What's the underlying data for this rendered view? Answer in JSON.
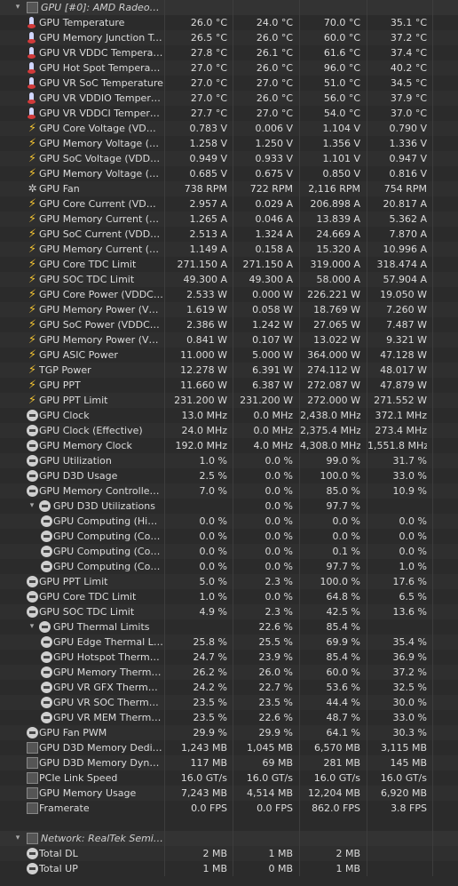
{
  "sections": [
    {
      "header": "GPU [#0]: AMD Radeon R...",
      "rows": [
        {
          "icon": "temp",
          "label": "GPU Temperature",
          "v": [
            "26.0 °C",
            "24.0 °C",
            "70.0 °C",
            "35.1 °C"
          ]
        },
        {
          "icon": "temp",
          "label": "GPU Memory Junction Tem...",
          "v": [
            "26.5 °C",
            "26.0 °C",
            "60.0 °C",
            "37.2 °C"
          ]
        },
        {
          "icon": "temp",
          "label": "GPU VR VDDC Temperature",
          "v": [
            "27.8 °C",
            "26.1 °C",
            "61.6 °C",
            "37.4 °C"
          ]
        },
        {
          "icon": "temp",
          "label": "GPU Hot Spot Temperature",
          "v": [
            "27.0 °C",
            "26.0 °C",
            "96.0 °C",
            "40.2 °C"
          ]
        },
        {
          "icon": "temp",
          "label": "GPU VR SoC Temperature",
          "v": [
            "27.0 °C",
            "27.0 °C",
            "51.0 °C",
            "34.5 °C"
          ]
        },
        {
          "icon": "temp",
          "label": "GPU VR VDDIO Temperature",
          "v": [
            "27.0 °C",
            "26.0 °C",
            "56.0 °C",
            "37.9 °C"
          ]
        },
        {
          "icon": "temp",
          "label": "GPU VR VDDCI Temperature",
          "v": [
            "27.7 °C",
            "27.0 °C",
            "54.0 °C",
            "37.0 °C"
          ]
        },
        {
          "icon": "volt",
          "label": "GPU Core Voltage (VDDCR...",
          "v": [
            "0.783 V",
            "0.006 V",
            "1.104 V",
            "0.790 V"
          ]
        },
        {
          "icon": "volt",
          "label": "GPU Memory Voltage (VDD...",
          "v": [
            "1.258 V",
            "1.250 V",
            "1.356 V",
            "1.336 V"
          ]
        },
        {
          "icon": "volt",
          "label": "GPU SoC Voltage (VDDCR_...",
          "v": [
            "0.949 V",
            "0.933 V",
            "1.101 V",
            "0.947 V"
          ]
        },
        {
          "icon": "volt",
          "label": "GPU Memory Voltage (VDD...",
          "v": [
            "0.685 V",
            "0.675 V",
            "0.850 V",
            "0.816 V"
          ]
        },
        {
          "icon": "fan",
          "label": "GPU Fan",
          "v": [
            "738 RPM",
            "722 RPM",
            "2,116 RPM",
            "754 RPM"
          ]
        },
        {
          "icon": "volt",
          "label": "GPU Core Current (VDDCR...",
          "v": [
            "2.957 A",
            "0.029 A",
            "206.898 A",
            "20.817 A"
          ]
        },
        {
          "icon": "volt",
          "label": "GPU Memory Current (VDD...",
          "v": [
            "1.265 A",
            "0.046 A",
            "13.839 A",
            "5.362 A"
          ]
        },
        {
          "icon": "volt",
          "label": "GPU SoC Current (VDDCR...",
          "v": [
            "2.513 A",
            "1.324 A",
            "24.669 A",
            "7.870 A"
          ]
        },
        {
          "icon": "volt",
          "label": "GPU Memory Current (VDD...",
          "v": [
            "1.149 A",
            "0.158 A",
            "15.320 A",
            "10.996 A"
          ]
        },
        {
          "icon": "volt",
          "label": "GPU Core TDC Limit",
          "v": [
            "271.150 A",
            "271.150 A",
            "319.000 A",
            "318.474 A"
          ]
        },
        {
          "icon": "volt",
          "label": "GPU SOC TDC Limit",
          "v": [
            "49.300 A",
            "49.300 A",
            "58.000 A",
            "57.904 A"
          ]
        },
        {
          "icon": "volt",
          "label": "GPU Core Power (VDDCR_...",
          "v": [
            "2.533 W",
            "0.000 W",
            "226.221 W",
            "19.050 W"
          ]
        },
        {
          "icon": "volt",
          "label": "GPU Memory Power (VDDIO)",
          "v": [
            "1.619 W",
            "0.058 W",
            "18.769 W",
            "7.260 W"
          ]
        },
        {
          "icon": "volt",
          "label": "GPU SoC Power (VDDCR_S...",
          "v": [
            "2.386 W",
            "1.242 W",
            "27.065 W",
            "7.487 W"
          ]
        },
        {
          "icon": "volt",
          "label": "GPU Memory Power (VDDC...",
          "v": [
            "0.841 W",
            "0.107 W",
            "13.022 W",
            "9.321 W"
          ]
        },
        {
          "icon": "volt",
          "label": "GPU ASIC Power",
          "v": [
            "11.000 W",
            "5.000 W",
            "364.000 W",
            "47.128 W"
          ]
        },
        {
          "icon": "volt",
          "label": "TGP Power",
          "v": [
            "12.278 W",
            "6.391 W",
            "274.112 W",
            "48.017 W"
          ]
        },
        {
          "icon": "volt",
          "label": "GPU PPT",
          "v": [
            "11.660 W",
            "6.387 W",
            "272.087 W",
            "47.879 W"
          ]
        },
        {
          "icon": "volt",
          "label": "GPU PPT Limit",
          "v": [
            "231.200 W",
            "231.200 W",
            "272.000 W",
            "271.552 W"
          ]
        },
        {
          "icon": "clock",
          "label": "GPU Clock",
          "v": [
            "13.0 MHz",
            "0.0 MHz",
            "2,438.0 MHz",
            "372.1 MHz"
          ]
        },
        {
          "icon": "clock",
          "label": "GPU Clock (Effective)",
          "v": [
            "24.0 MHz",
            "0.0 MHz",
            "2,375.4 MHz",
            "273.4 MHz"
          ]
        },
        {
          "icon": "clock",
          "label": "GPU Memory Clock",
          "v": [
            "192.0 MHz",
            "4.0 MHz",
            "4,308.0 MHz",
            "1,551.8 MHz"
          ]
        },
        {
          "icon": "clock",
          "label": "GPU Utilization",
          "v": [
            "1.0 %",
            "0.0 %",
            "99.0 %",
            "31.7 %"
          ]
        },
        {
          "icon": "clock",
          "label": "GPU D3D Usage",
          "v": [
            "2.5 %",
            "0.0 %",
            "100.0 %",
            "33.0 %"
          ]
        },
        {
          "icon": "clock",
          "label": "GPU Memory Controller Uti...",
          "v": [
            "7.0 %",
            "0.0 %",
            "85.0 %",
            "10.9 %"
          ]
        },
        {
          "icon": "clock",
          "label": "GPU D3D Utilizations",
          "group": true,
          "v": [
            "",
            "0.0 %",
            "97.7 %",
            ""
          ]
        },
        {
          "icon": "clock",
          "label": "GPU Computing (High P...",
          "indent": true,
          "v": [
            "0.0 %",
            "0.0 %",
            "0.0 %",
            "0.0 %"
          ]
        },
        {
          "icon": "clock",
          "label": "GPU Computing (Comp...",
          "indent": true,
          "v": [
            "0.0 %",
            "0.0 %",
            "0.0 %",
            "0.0 %"
          ]
        },
        {
          "icon": "clock",
          "label": "GPU Computing (Comp...",
          "indent": true,
          "v": [
            "0.0 %",
            "0.0 %",
            "0.1 %",
            "0.0 %"
          ]
        },
        {
          "icon": "clock",
          "label": "GPU Computing (Comp...",
          "indent": true,
          "v": [
            "0.0 %",
            "0.0 %",
            "97.7 %",
            "1.0 %"
          ]
        },
        {
          "icon": "clock",
          "label": "GPU PPT Limit",
          "v": [
            "5.0 %",
            "2.3 %",
            "100.0 %",
            "17.6 %"
          ]
        },
        {
          "icon": "clock",
          "label": "GPU Core TDC Limit",
          "v": [
            "1.0 %",
            "0.0 %",
            "64.8 %",
            "6.5 %"
          ]
        },
        {
          "icon": "clock",
          "label": "GPU SOC TDC Limit",
          "v": [
            "4.9 %",
            "2.3 %",
            "42.5 %",
            "13.6 %"
          ]
        },
        {
          "icon": "clock",
          "label": "GPU Thermal Limits",
          "group": true,
          "v": [
            "",
            "22.6 %",
            "85.4 %",
            ""
          ]
        },
        {
          "icon": "clock",
          "label": "GPU Edge Thermal Limit",
          "indent": true,
          "v": [
            "25.8 %",
            "25.5 %",
            "69.9 %",
            "35.4 %"
          ]
        },
        {
          "icon": "clock",
          "label": "GPU Hotspot Thermal Li...",
          "indent": true,
          "v": [
            "24.7 %",
            "23.9 %",
            "85.4 %",
            "36.9 %"
          ]
        },
        {
          "icon": "clock",
          "label": "GPU Memory Thermal Li...",
          "indent": true,
          "v": [
            "26.2 %",
            "26.0 %",
            "60.0 %",
            "37.2 %"
          ]
        },
        {
          "icon": "clock",
          "label": "GPU VR GFX Thermal Limit",
          "indent": true,
          "v": [
            "24.2 %",
            "22.7 %",
            "53.6 %",
            "32.5 %"
          ]
        },
        {
          "icon": "clock",
          "label": "GPU VR SOC Thermal Li...",
          "indent": true,
          "v": [
            "23.5 %",
            "23.5 %",
            "44.4 %",
            "30.0 %"
          ]
        },
        {
          "icon": "clock",
          "label": "GPU VR MEM Thermal Li...",
          "indent": true,
          "v": [
            "23.5 %",
            "22.6 %",
            "48.7 %",
            "33.0 %"
          ]
        },
        {
          "icon": "clock",
          "label": "GPU Fan PWM",
          "v": [
            "29.9 %",
            "29.9 %",
            "64.1 %",
            "30.3 %"
          ]
        },
        {
          "icon": "chip",
          "label": "GPU D3D Memory Dedicated",
          "v": [
            "1,243 MB",
            "1,045 MB",
            "6,570 MB",
            "3,115 MB"
          ]
        },
        {
          "icon": "chip",
          "label": "GPU D3D Memory Dynamic",
          "v": [
            "117 MB",
            "69 MB",
            "281 MB",
            "145 MB"
          ]
        },
        {
          "icon": "chip",
          "label": "PCIe Link Speed",
          "v": [
            "16.0 GT/s",
            "16.0 GT/s",
            "16.0 GT/s",
            "16.0 GT/s"
          ]
        },
        {
          "icon": "chip",
          "label": "GPU Memory Usage",
          "v": [
            "7,243 MB",
            "4,514 MB",
            "12,204 MB",
            "6,920 MB"
          ]
        },
        {
          "icon": "chip",
          "label": "Framerate",
          "v": [
            "0.0 FPS",
            "0.0 FPS",
            "862.0 FPS",
            "3.8 FPS"
          ]
        }
      ]
    },
    {
      "header": "Network: RealTek Semicon...",
      "rows": [
        {
          "icon": "clock",
          "label": "Total DL",
          "v": [
            "2 MB",
            "1 MB",
            "2 MB",
            ""
          ]
        },
        {
          "icon": "clock",
          "label": "Total UP",
          "v": [
            "1 MB",
            "0 MB",
            "1 MB",
            ""
          ]
        }
      ]
    }
  ],
  "icons": {
    "temp": "thermometer-icon",
    "volt": "lightning-icon",
    "fan": "fan-icon",
    "clock": "gauge-icon",
    "chip": "chip-icon"
  },
  "expander_symbol": "▾"
}
